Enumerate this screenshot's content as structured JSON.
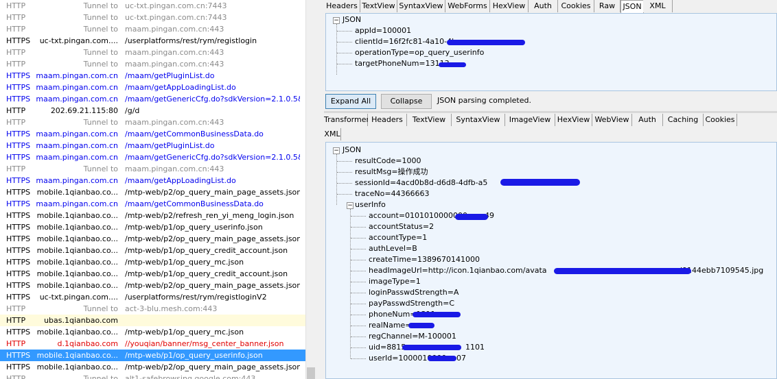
{
  "sessions": [
    {
      "protocol": "HTTP",
      "host": "Tunnel to",
      "url": "uc-txt.pingan.com.cn:7443",
      "style": "tunnel"
    },
    {
      "protocol": "HTTP",
      "host": "Tunnel to",
      "url": "uc-txt.pingan.com.cn:7443",
      "style": "tunnel"
    },
    {
      "protocol": "HTTP",
      "host": "Tunnel to",
      "url": "maam.pingan.com.cn:443",
      "style": "tunnel"
    },
    {
      "protocol": "HTTPS",
      "host": "uc-txt.pingan.com....",
      "url": "/userplatforms/rest/rym/registlogin",
      "style": "normal"
    },
    {
      "protocol": "HTTP",
      "host": "Tunnel to",
      "url": "maam.pingan.com.cn:443",
      "style": "tunnel"
    },
    {
      "protocol": "HTTP",
      "host": "Tunnel to",
      "url": "maam.pingan.com.cn:443",
      "style": "tunnel"
    },
    {
      "protocol": "HTTPS",
      "host": "maam.pingan.com.cn",
      "url": "/maam/getPluginList.do",
      "style": "blue"
    },
    {
      "protocol": "HTTPS",
      "host": "maam.pingan.com.cn",
      "url": "/maam/getAppLoadingList.do",
      "style": "blue"
    },
    {
      "protocol": "HTTPS",
      "host": "maam.pingan.com.cn",
      "url": "/maam/getGenericCfg.do?sdkVersion=2.1.0.5&os...",
      "style": "blue"
    },
    {
      "protocol": "HTTP",
      "host": "202.69.21.115:80",
      "url": "/g/d",
      "style": "normal"
    },
    {
      "protocol": "HTTP",
      "host": "Tunnel to",
      "url": "maam.pingan.com.cn:443",
      "style": "tunnel"
    },
    {
      "protocol": "HTTPS",
      "host": "maam.pingan.com.cn",
      "url": "/maam/getCommonBusinessData.do",
      "style": "blue"
    },
    {
      "protocol": "HTTPS",
      "host": "maam.pingan.com.cn",
      "url": "/maam/getPluginList.do",
      "style": "blue"
    },
    {
      "protocol": "HTTPS",
      "host": "maam.pingan.com.cn",
      "url": "/maam/getGenericCfg.do?sdkVersion=2.1.0.5&os...",
      "style": "blue"
    },
    {
      "protocol": "HTTP",
      "host": "Tunnel to",
      "url": "maam.pingan.com.cn:443",
      "style": "tunnel"
    },
    {
      "protocol": "HTTPS",
      "host": "maam.pingan.com.cn",
      "url": "/maam/getAppLoadingList.do",
      "style": "blue"
    },
    {
      "protocol": "HTTPS",
      "host": "mobile.1qianbao.co...",
      "url": "/mtp-web/p2/op_query_main_page_assets.json",
      "style": "normal"
    },
    {
      "protocol": "HTTPS",
      "host": "maam.pingan.com.cn",
      "url": "/maam/getCommonBusinessData.do",
      "style": "blue"
    },
    {
      "protocol": "HTTPS",
      "host": "mobile.1qianbao.co...",
      "url": "/mtp-web/p2/refresh_ren_yi_meng_login.json",
      "style": "normal"
    },
    {
      "protocol": "HTTPS",
      "host": "mobile.1qianbao.co...",
      "url": "/mtp-web/p1/op_query_userinfo.json",
      "style": "normal"
    },
    {
      "protocol": "HTTPS",
      "host": "mobile.1qianbao.co...",
      "url": "/mtp-web/p2/op_query_main_page_assets.json",
      "style": "normal"
    },
    {
      "protocol": "HTTPS",
      "host": "mobile.1qianbao.co...",
      "url": "/mtp-web/p1/op_query_credit_account.json",
      "style": "normal"
    },
    {
      "protocol": "HTTPS",
      "host": "mobile.1qianbao.co...",
      "url": "/mtp-web/p1/op_query_mc.json",
      "style": "normal"
    },
    {
      "protocol": "HTTPS",
      "host": "mobile.1qianbao.co...",
      "url": "/mtp-web/p1/op_query_credit_account.json",
      "style": "normal"
    },
    {
      "protocol": "HTTPS",
      "host": "mobile.1qianbao.co...",
      "url": "/mtp-web/p2/op_query_main_page_assets.json",
      "style": "normal"
    },
    {
      "protocol": "HTTPS",
      "host": "uc-txt.pingan.com....",
      "url": "/userplatforms/rest/rym/registloginV2",
      "style": "normal"
    },
    {
      "protocol": "HTTP",
      "host": "Tunnel to",
      "url": "act-3-blu.mesh.com:443",
      "style": "tunnel"
    },
    {
      "protocol": "HTTP",
      "host": "ubas.1qianbao.com",
      "url": "",
      "style": "highlight"
    },
    {
      "protocol": "HTTPS",
      "host": "mobile.1qianbao.co...",
      "url": "/mtp-web/p1/op_query_mc.json",
      "style": "normal"
    },
    {
      "protocol": "HTTP",
      "host": "d.1qianbao.com",
      "url": "//youqian/banner/msg_center_banner.json",
      "style": "red"
    },
    {
      "protocol": "HTTPS",
      "host": "mobile.1qianbao.co...",
      "url": "/mtp-web/p1/op_query_userinfo.json",
      "style": "selected"
    },
    {
      "protocol": "HTTPS",
      "host": "mobile.1qianbao.co...",
      "url": "/mtp-web/p2/op_query_main_page_assets.json",
      "style": "normal"
    },
    {
      "protocol": "HTTP",
      "host": "Tunnel to",
      "url": "alt1-safebrowsing.google.com:443",
      "style": "tunnel"
    }
  ],
  "request_tabs": [
    "Headers",
    "TextView",
    "SyntaxView",
    "WebForms",
    "HexView",
    "Auth",
    "Cookies",
    "Raw",
    "JSON",
    "XML"
  ],
  "request_active_tab": "JSON",
  "request_tree": {
    "root": "JSON",
    "items": [
      "appId=100001",
      "clientId=16f2fc81-4a10-4b",
      "operationType=op_query_userinfo",
      "targetPhoneNum=13113"
    ]
  },
  "buttons": {
    "expand_all": "Expand All",
    "collapse": "Collapse"
  },
  "status_text": "JSON parsing completed.",
  "response_tabs_row1": [
    "Transformer",
    "Headers",
    "TextView",
    "SyntaxView",
    "ImageView",
    "HexView",
    "WebView",
    "Auth",
    "Caching",
    "Cookies"
  ],
  "response_tabs_row2": [
    "XML"
  ],
  "response_tree": {
    "root": "JSON",
    "items": [
      "resultCode=1000",
      "resultMsg=操作成功",
      "sessionId=4acd0b8d-d6d8-4dfb-a5",
      "traceNo=44366663"
    ],
    "group": "userInfo",
    "children": [
      "account=0101010000000",
      "accountStatus=2",
      "accountType=1",
      "authLevel=B",
      "createTime=1389670141000",
      "headImageUrl=http://icon.1qianbao.com/avata",
      "imageType=1",
      "loginPasswdStrength=A",
      "payPasswdStrength=C",
      "phoneNum=1311",
      "realName=",
      "regChannel=M-100001",
      "uid=8815",
      "userId=1000010000"
    ]
  },
  "tail_fragments": {
    "account": "49",
    "headImageUrl": "d9144ebb7109545.jpg",
    "uid": "1101",
    "userId": "07"
  },
  "colors": {
    "selection": "#3399ff",
    "link_blue": "#0000ee",
    "error_red": "#e00000",
    "tunnel_gray": "#8a8a8a",
    "redaction": "#1a1ae6"
  }
}
